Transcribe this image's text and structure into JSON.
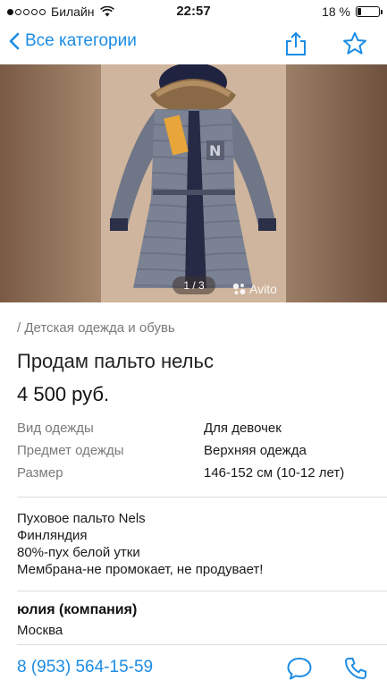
{
  "status_bar": {
    "carrier": "Билайн",
    "time": "22:57",
    "battery": "18 %",
    "battery_level": 0.18,
    "signal_bars_filled": 1,
    "signal_bars_total": 5
  },
  "nav": {
    "back_label": "Все категории",
    "share_icon": "share-icon",
    "favorite_icon": "star-icon"
  },
  "gallery": {
    "counter": "1 / 3",
    "watermark": "Avito"
  },
  "listing": {
    "breadcrumb": "/ Детская одежда и обувь",
    "title": "Продам пальто нельс",
    "price": "4 500 руб.",
    "specs": [
      {
        "key": "Вид одежды",
        "value": "Для девочек"
      },
      {
        "key": "Предмет одежды",
        "value": "Верхняя одежда"
      },
      {
        "key": "Размер",
        "value": "146-152 см (10-12 лет)"
      }
    ],
    "description": [
      "Пуховое пальто Nels",
      "Финляндия",
      "80%-пух белой утки",
      "Мембрана-не промокает, не продувает!"
    ]
  },
  "seller": {
    "name": "юлия (компания)",
    "city": "Москва"
  },
  "contact": {
    "phone": "8 (953) 564-15-59",
    "message_icon": "chat-bubble-icon",
    "call_icon": "phone-icon"
  },
  "colors": {
    "accent": "#1b8ce4",
    "muted_text": "#7a7a7a",
    "divider": "#dcdcdc"
  }
}
